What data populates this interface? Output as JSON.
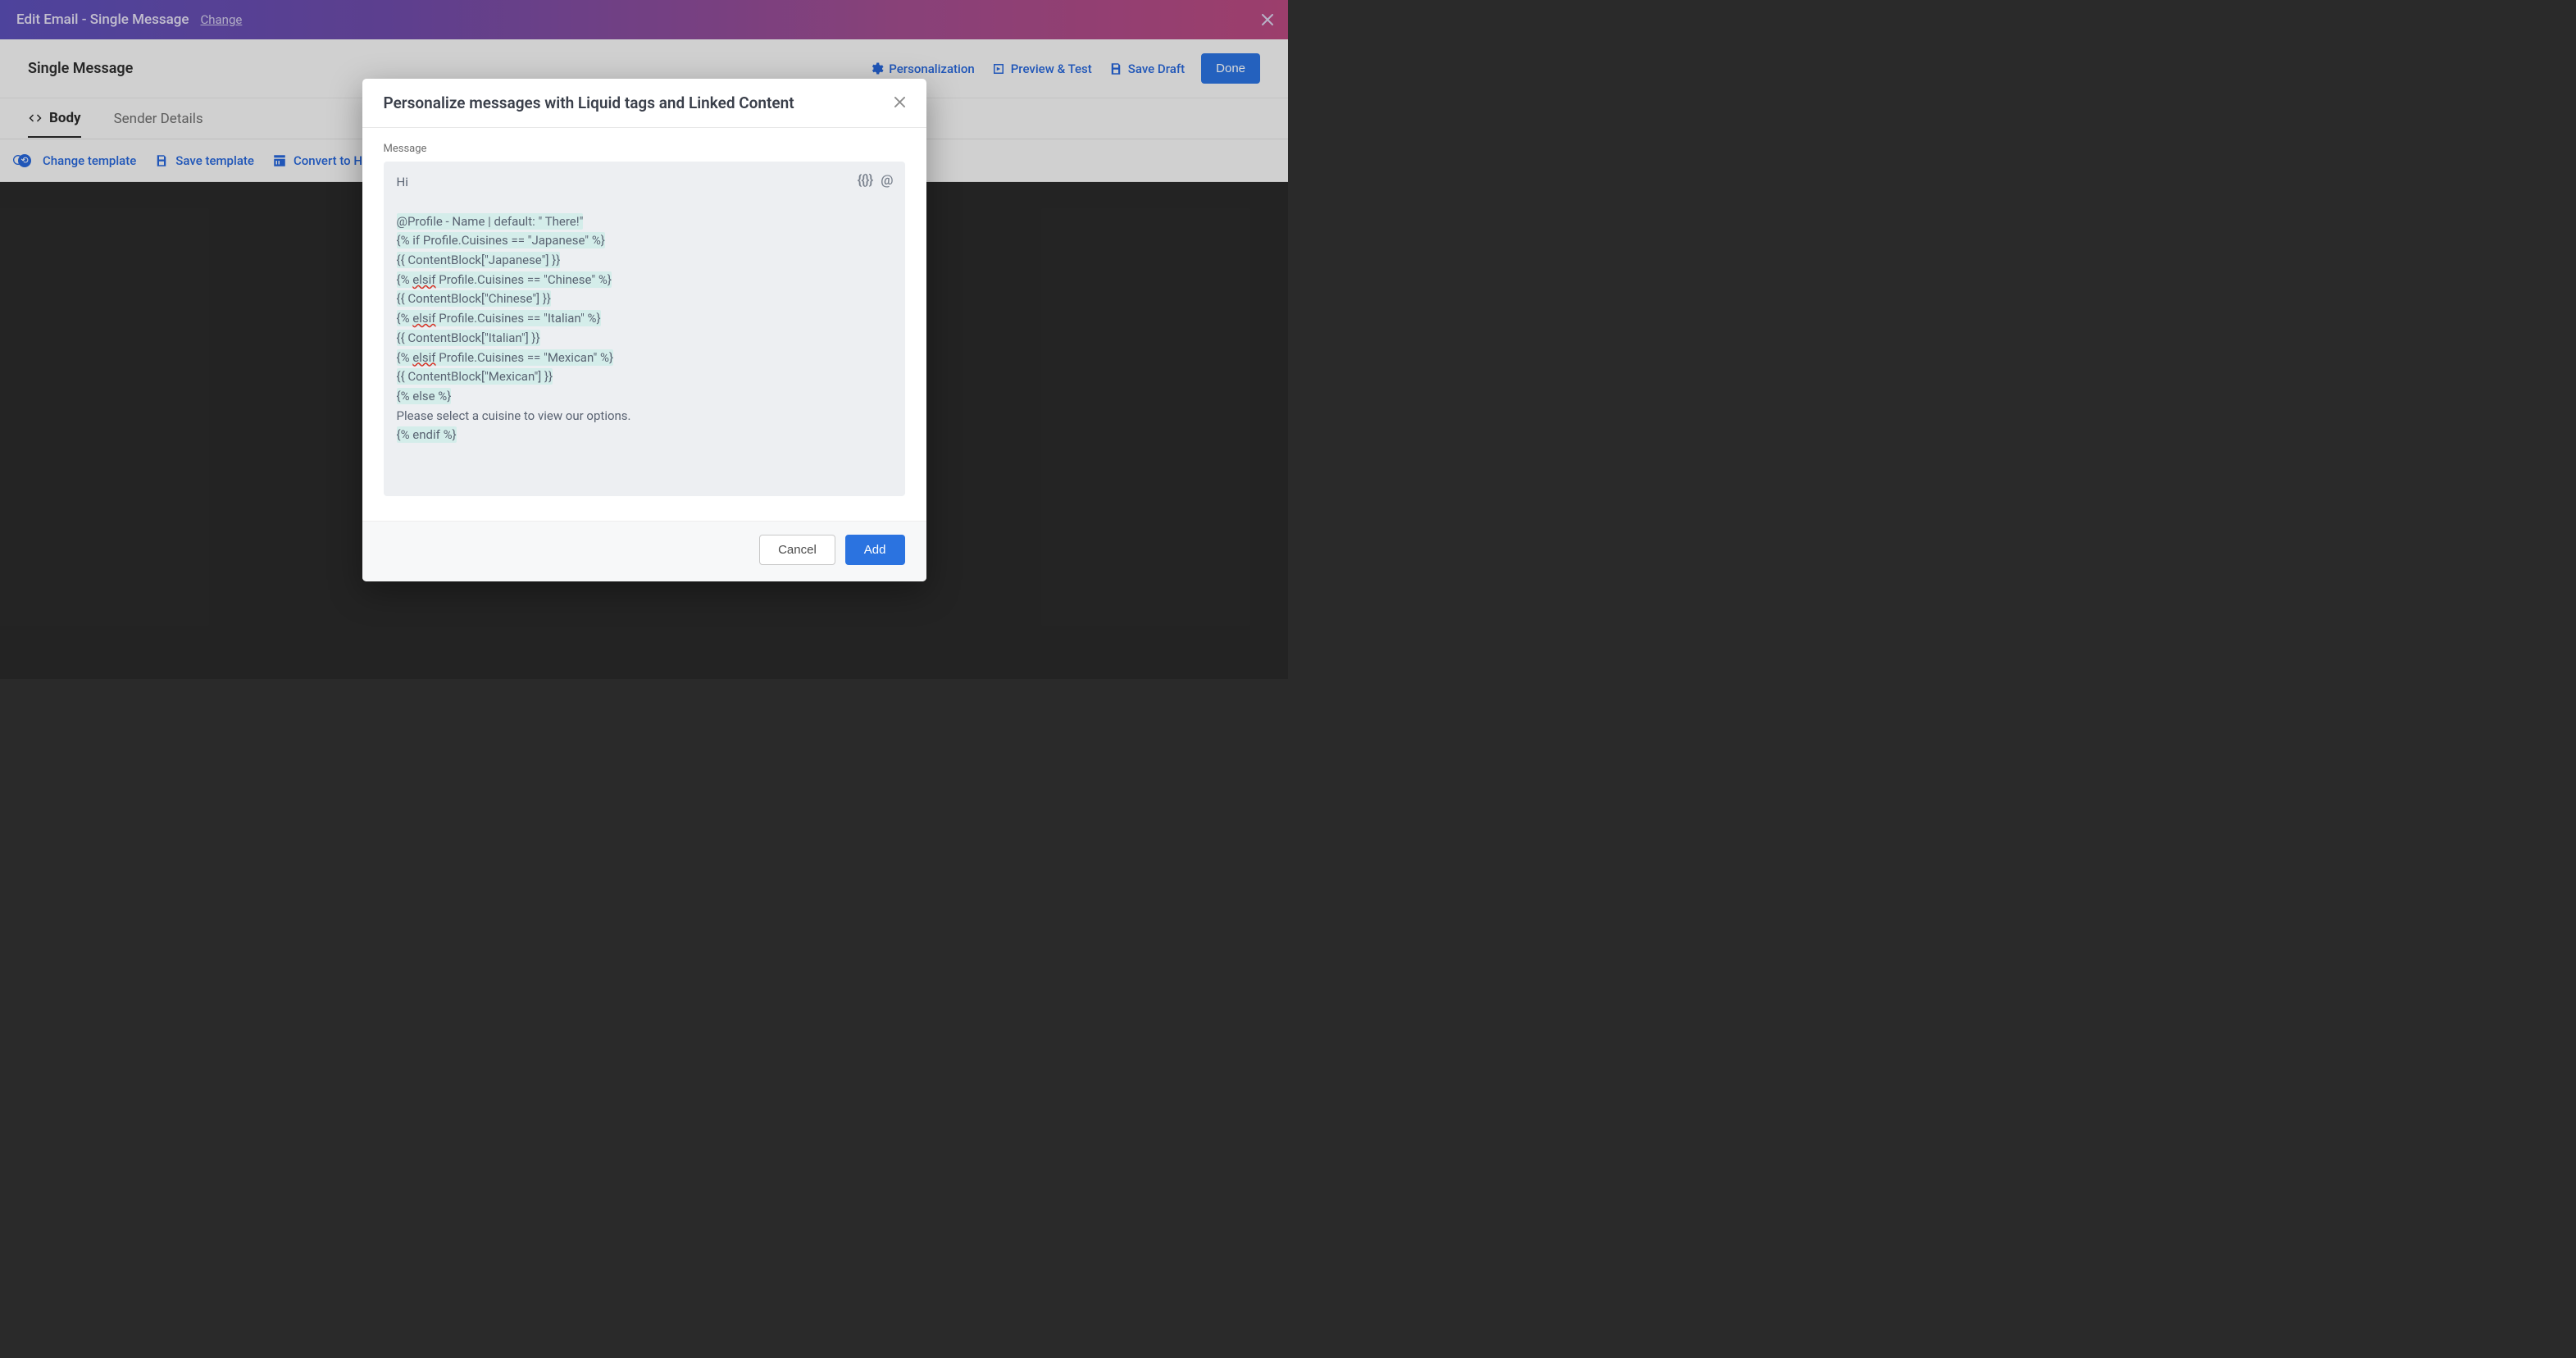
{
  "top_bar": {
    "title": "Edit Email - Single Message",
    "change_link": "Change"
  },
  "action_bar": {
    "title": "Single Message",
    "personalization": "Personalization",
    "preview_test": "Preview & Test",
    "save_draft": "Save Draft",
    "done": "Done"
  },
  "tabs": {
    "body": "Body",
    "sender_details": "Sender Details"
  },
  "toolbar": {
    "change_template": "Change template",
    "save_template": "Save template",
    "convert_html": "Convert to HTML"
  },
  "modal": {
    "title": "Personalize messages with Liquid tags and Linked Content",
    "field_label": "Message",
    "tool_braces": "{{}}",
    "tool_at": "@",
    "lines": {
      "l0": "Hi",
      "l1": "@Profile - Name | default: \" There!\"",
      "l2a": "{% if Profile.Cuisines == \"Japanese\" %}",
      "l3": "{{ ContentBlock[\"Japanese\"] }}",
      "l4a": "{% ",
      "l4b": "elsif",
      "l4c": " Profile.Cuisines == \"Chinese\" %}",
      "l5": "{{ ContentBlock[\"Chinese\"] }}",
      "l6a": "{% ",
      "l6b": "elsif",
      "l6c": " Profile.Cuisines == \"Italian\" %}",
      "l7": "{{ ContentBlock[\"Italian\"] }}",
      "l8a": "{% ",
      "l8b": "elsif",
      "l8c": " Profile.Cuisines == \"Mexican\" %}",
      "l9": "{{ ContentBlock[\"Mexican\"] }}",
      "l10": "{% else %}",
      "l11": "Please select a cuisine to view our options.",
      "l12": "{% endif %}"
    },
    "cancel": "Cancel",
    "add": "Add"
  }
}
